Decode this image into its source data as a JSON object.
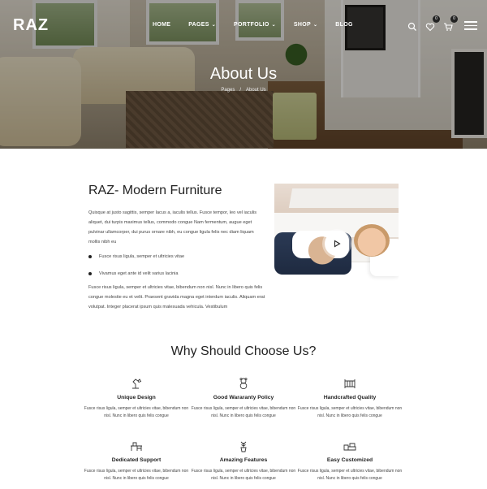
{
  "header": {
    "logo": "RAZ",
    "nav": [
      {
        "label": "HOME",
        "has_dropdown": false
      },
      {
        "label": "PAGES",
        "has_dropdown": true
      },
      {
        "label": "PORTFOLIO",
        "has_dropdown": true
      },
      {
        "label": "SHOP",
        "has_dropdown": true
      },
      {
        "label": "BLOG",
        "has_dropdown": false
      }
    ],
    "wishlist_count": "0",
    "cart_count": "0",
    "icons": [
      "search-icon",
      "heart-icon",
      "cart-icon",
      "menu-icon"
    ]
  },
  "hero": {
    "title": "About Us",
    "breadcrumb": [
      "Pages",
      "About Us"
    ],
    "breadcrumb_sep": "/"
  },
  "about": {
    "title": "RAZ- Modern Furniture",
    "paragraph1": "Quisque at justo sagittis, semper lacus a, iaculis tellus. Fusce tempor, leo vel iaculis aliquet, dui turpis maximus tellus, commodo congue Nam fermentum, augue eget pulvinar ullamcorper, dui purus ornare nibh, eu congue ligula felis nec diam liquam mollis nibh eu",
    "bullets": [
      "Fusce risus ligula, semper et ultricies vitae",
      "Vivamus eget ante id velit varius lacinia"
    ],
    "paragraph2": "Fusce risus ligula, semper et ultricies vitae, bibendum non nisl. Nunc in libero quis felis congue molestie eu et velit. Praesent gravida magna eget interdum iaculis. Aliquam erat volutpat. Integer placerat ipsum quis malesuada vehicula. Vestibulum",
    "video_button": "play-icon"
  },
  "why": {
    "title": "Why Should Choose Us?",
    "features": [
      {
        "icon": "lamp-icon",
        "title": "Unique Design",
        "text": "Fusce risus ligula, semper et ultricies vitae, bibendum non nisl. Nunc in libero quis felis congue"
      },
      {
        "icon": "teddy-bear-icon",
        "title": "Good Wararanty Policy",
        "text": "Fusce risus ligula, semper et ultricies vitae, bibendum non nisl. Nunc in libero quis felis congue"
      },
      {
        "icon": "crib-icon",
        "title": "Handcrafted Quality",
        "text": "Fusce risus ligula, semper et ultricies vitae, bibendum non nisl. Nunc in libero quis felis congue"
      },
      {
        "icon": "desk-icon",
        "title": "Dedicated Support",
        "text": "Fusce risus ligula, semper et ultricies vitae, bibendum non nisl. Nunc in libero quis felis congue"
      },
      {
        "icon": "plant-icon",
        "title": "Amazing Features",
        "text": "Fusce risus ligula, semper et ultricies vitae, bibendum non nisl. Nunc in libero quis felis congue"
      },
      {
        "icon": "sofa-icon",
        "title": "Easy Customized",
        "text": "Fusce risus ligula, semper et ultricies vitae, bibendum non nisl. Nunc in libero quis felis congue"
      }
    ]
  }
}
